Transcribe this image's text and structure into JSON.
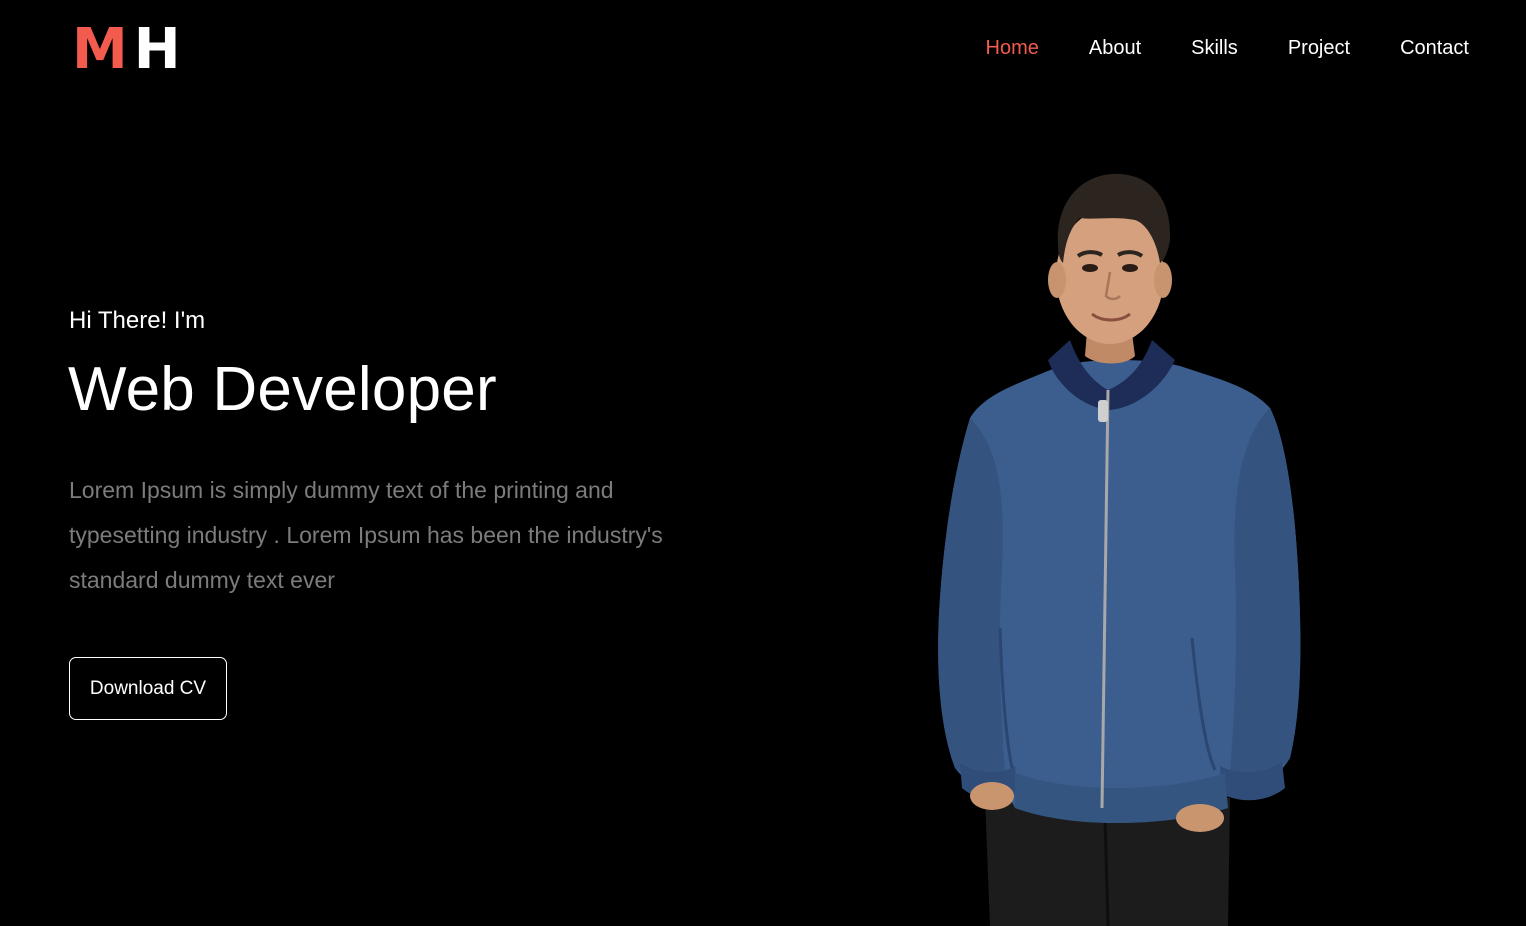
{
  "logo": {
    "first_letter": "M",
    "second_letter": "H",
    "accent_color": "#f25b4e"
  },
  "nav": {
    "items": [
      {
        "label": "Home",
        "active": true
      },
      {
        "label": "About",
        "active": false
      },
      {
        "label": "Skills",
        "active": false
      },
      {
        "label": "Project",
        "active": false
      },
      {
        "label": "Contact",
        "active": false
      }
    ]
  },
  "hero": {
    "greeting": "Hi There! I'm",
    "role": "Web Developer",
    "description": "Lorem Ipsum is simply dummy text of the printing and typesetting industry . Lorem Ipsum has been the industry's standard dummy text ever",
    "cv_button_label": "Download CV"
  },
  "colors": {
    "background": "#000000",
    "accent": "#f25b4e",
    "muted_text": "#7c7c7c",
    "jacket": "#3b5e8f"
  }
}
